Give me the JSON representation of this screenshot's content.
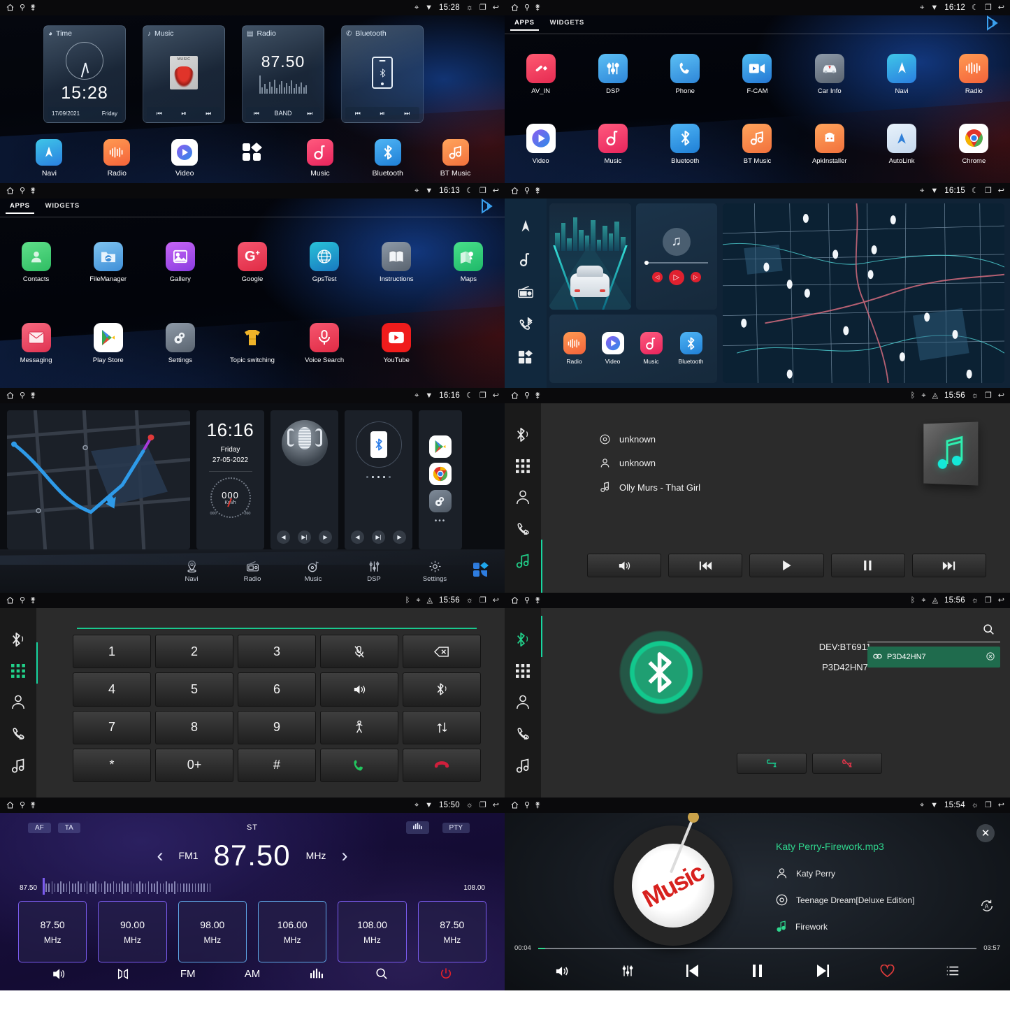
{
  "status_bar": {
    "icons_left": [
      "home-icon",
      "usb-icon",
      "antenna-icon"
    ],
    "icons_right": [
      "gps-icon",
      "wifi-icon",
      "brightness-icon",
      "recents-icon",
      "back-icon"
    ],
    "times": {
      "p1": "15:28",
      "p2": "16:12",
      "p3": "16:13",
      "p4": "16:15",
      "p5": "16:16",
      "p6": "15:56",
      "p7": "15:56",
      "p8": "15:56",
      "p9": "15:50",
      "p10": "15:54"
    }
  },
  "home": {
    "widgets": [
      {
        "title": "Time",
        "icon": "clock-icon",
        "time": "15:28",
        "date": "17/09/2021",
        "day": "Friday",
        "controls": [
          "prev-icon",
          "play-pause-icon",
          "next-icon"
        ]
      },
      {
        "title": "Music",
        "icon": "music-note-icon",
        "controls": [
          "prev-icon",
          "play-pause-icon",
          "next-icon"
        ]
      },
      {
        "title": "Radio",
        "icon": "radio-icon",
        "freq": "87.50",
        "band_label": "BAND",
        "controls": [
          "prev-icon",
          "BAND",
          "next-icon"
        ]
      },
      {
        "title": "Bluetooth",
        "icon": "phone-icon",
        "controls": [
          "prev-icon",
          "play-pause-icon",
          "next-icon"
        ]
      }
    ],
    "dock": [
      {
        "label": "Navi",
        "icon": "navi-icon"
      },
      {
        "label": "Radio",
        "icon": "radio-icon"
      },
      {
        "label": "Video",
        "icon": "video-icon"
      },
      {
        "label": "",
        "icon": "apps-grid-icon"
      },
      {
        "label": "Music",
        "icon": "music-icon"
      },
      {
        "label": "Bluetooth",
        "icon": "bluetooth-icon"
      },
      {
        "label": "BT Music",
        "icon": "bt-music-icon"
      }
    ]
  },
  "drawer": {
    "tabs": [
      {
        "label": "APPS",
        "active": true
      },
      {
        "label": "WIDGETS",
        "active": false
      }
    ],
    "play_badge": "play-store-icon",
    "page1": [
      {
        "label": "AV_IN",
        "icon": "av-in-icon"
      },
      {
        "label": "DSP",
        "icon": "dsp-icon"
      },
      {
        "label": "Phone",
        "icon": "phone-icon"
      },
      {
        "label": "F-CAM",
        "icon": "front-camera-icon"
      },
      {
        "label": "Car Info",
        "icon": "car-info-icon"
      },
      {
        "label": "Navi",
        "icon": "navi-icon"
      },
      {
        "label": "Radio",
        "icon": "radio-icon"
      },
      {
        "label": "Video",
        "icon": "video-icon"
      },
      {
        "label": "Music",
        "icon": "music-icon"
      },
      {
        "label": "Bluetooth",
        "icon": "bluetooth-icon"
      },
      {
        "label": "BT Music",
        "icon": "bt-music-icon"
      },
      {
        "label": "ApkInstaller",
        "icon": "apk-installer-icon"
      },
      {
        "label": "AutoLink",
        "icon": "autolink-icon"
      },
      {
        "label": "Chrome",
        "icon": "chrome-icon"
      }
    ],
    "page2": [
      {
        "label": "Contacts",
        "icon": "contacts-icon"
      },
      {
        "label": "FileManager",
        "icon": "file-manager-icon"
      },
      {
        "label": "Gallery",
        "icon": "gallery-icon"
      },
      {
        "label": "Google",
        "icon": "google-icon"
      },
      {
        "label": "GpsTest",
        "icon": "gps-test-icon"
      },
      {
        "label": "Instructions",
        "icon": "instructions-icon"
      },
      {
        "label": "Maps",
        "icon": "maps-icon"
      },
      {
        "label": "Messaging",
        "icon": "messaging-icon"
      },
      {
        "label": "Play Store",
        "icon": "play-store-icon"
      },
      {
        "label": "Settings",
        "icon": "settings-icon"
      },
      {
        "label": "Topic switching",
        "icon": "topic-switching-icon"
      },
      {
        "label": "Voice Search",
        "icon": "voice-search-icon"
      },
      {
        "label": "YouTube",
        "icon": "youtube-icon"
      }
    ]
  },
  "navi_home": {
    "sidebar": [
      "navi-icon",
      "music-icon",
      "radio-icon",
      "bt-phone-icon",
      "apps-grid-icon"
    ],
    "shortcuts": [
      {
        "label": "Radio",
        "icon": "radio-icon"
      },
      {
        "label": "Video",
        "icon": "video-icon"
      },
      {
        "label": "Music",
        "icon": "music-icon"
      },
      {
        "label": "Bluetooth",
        "icon": "bluetooth-icon"
      }
    ],
    "player_controls": [
      "prev-icon",
      "play-icon",
      "next-icon"
    ]
  },
  "dashboard": {
    "clock": {
      "time": "16:16",
      "day": "Friday",
      "date": "27-05-2022"
    },
    "gauge": {
      "value": "000",
      "unit": "Km/h",
      "min": "000",
      "max": "260"
    },
    "widget_controls": [
      "prev-icon",
      "play-pause-icon",
      "next-icon"
    ],
    "side_apps": [
      "play-store-icon",
      "chrome-icon",
      "settings-icon",
      "more-icon"
    ],
    "nav": [
      {
        "label": "Navi",
        "icon": "navi-pin-icon"
      },
      {
        "label": "Radio",
        "icon": "radio-icon"
      },
      {
        "label": "Music",
        "icon": "music-disc-icon"
      },
      {
        "label": "DSP",
        "icon": "dsp-sliders-icon"
      },
      {
        "label": "Settings",
        "icon": "gear-icon"
      }
    ],
    "grid_button": "apps-grid-icon"
  },
  "bt_module": {
    "sidebar": [
      "bluetooth-icon",
      "dialpad-icon",
      "contacts-icon",
      "call-log-icon",
      "bt-music-icon"
    ],
    "music": {
      "album": "unknown",
      "artist": "unknown",
      "track": "Olly Murs - That Girl",
      "album_icon": "disc-icon",
      "artist_icon": "person-icon",
      "track_icon": "music-note-icon",
      "controls": [
        "volume-icon",
        "prev-icon",
        "play-icon",
        "pause-icon",
        "next-icon"
      ]
    },
    "dialpad": {
      "keys": [
        {
          "label": "1",
          "type": "digit"
        },
        {
          "label": "2",
          "type": "digit"
        },
        {
          "label": "3",
          "type": "digit"
        },
        {
          "label": "",
          "type": "mic-mute-icon"
        },
        {
          "label": "",
          "type": "backspace-icon"
        },
        {
          "label": "4",
          "type": "digit"
        },
        {
          "label": "5",
          "type": "digit"
        },
        {
          "label": "6",
          "type": "digit"
        },
        {
          "label": "",
          "type": "volume-icon"
        },
        {
          "label": "",
          "type": "bluetooth-icon"
        },
        {
          "label": "7",
          "type": "digit"
        },
        {
          "label": "8",
          "type": "digit"
        },
        {
          "label": "9",
          "type": "digit"
        },
        {
          "label": "",
          "type": "transfer-person-icon"
        },
        {
          "label": "",
          "type": "swap-icon"
        },
        {
          "label": "*",
          "type": "digit"
        },
        {
          "label": "0+",
          "type": "digit"
        },
        {
          "label": "#",
          "type": "digit"
        },
        {
          "label": "",
          "type": "call-icon"
        },
        {
          "label": "",
          "type": "end-call-icon"
        }
      ]
    },
    "pairing": {
      "device_name": "DEV:BT6911",
      "device_code": "P3D42HN7",
      "search_icon": "search-icon",
      "found_device": "P3D42HN7",
      "found_device_icon": "link-icon",
      "found_device_remove": "remove-icon",
      "connect_icon": "connect-link-icon",
      "disconnect_icon": "disconnect-link-icon"
    }
  },
  "radio": {
    "af": "AF",
    "ta": "TA",
    "st": "ST",
    "eq_icon": "eq-icon",
    "pty": "PTY",
    "band": "FM1",
    "frequency": "87.50",
    "unit": "MHz",
    "prev_icon": "chevron-left-icon",
    "next_icon": "chevron-right-icon",
    "scale_min": "87.50",
    "scale_max": "108.00",
    "presets": [
      {
        "freq": "87.50",
        "unit": "MHz"
      },
      {
        "freq": "90.00",
        "unit": "MHz"
      },
      {
        "freq": "98.00",
        "unit": "MHz"
      },
      {
        "freq": "106.00",
        "unit": "MHz"
      },
      {
        "freq": "108.00",
        "unit": "MHz"
      },
      {
        "freq": "87.50",
        "unit": "MHz"
      }
    ],
    "bottom": [
      {
        "label": "",
        "icon": "volume-icon"
      },
      {
        "label": "",
        "icon": "balance-icon"
      },
      {
        "label": "FM",
        "icon": ""
      },
      {
        "label": "AM",
        "icon": ""
      },
      {
        "label": "",
        "icon": "eq-bars-icon"
      },
      {
        "label": "",
        "icon": "search-icon"
      },
      {
        "label": "",
        "icon": "power-icon"
      }
    ]
  },
  "music_player": {
    "title": "Katy Perry-Firework.mp3",
    "artist": "Katy Perry",
    "album": "Teenage Dream[Deluxe Edition]",
    "track": "Firework",
    "artist_icon": "person-icon",
    "album_icon": "disc-icon",
    "track_icon": "music-note-icon",
    "elapsed": "00:04",
    "duration": "03:57",
    "progress_percent": 1.7,
    "close_icon": "close-icon",
    "repeat_icon": "repeat-all-icon",
    "vinyl_label": "Music",
    "controls": [
      {
        "icon": "volume-icon"
      },
      {
        "icon": "equalizer-icon"
      },
      {
        "icon": "prev-icon"
      },
      {
        "icon": "pause-icon"
      },
      {
        "icon": "next-icon"
      },
      {
        "icon": "favorite-icon"
      },
      {
        "icon": "playlist-icon"
      }
    ],
    "accent_color": "#2fd78e",
    "favorite_color": "#e03b3b"
  }
}
